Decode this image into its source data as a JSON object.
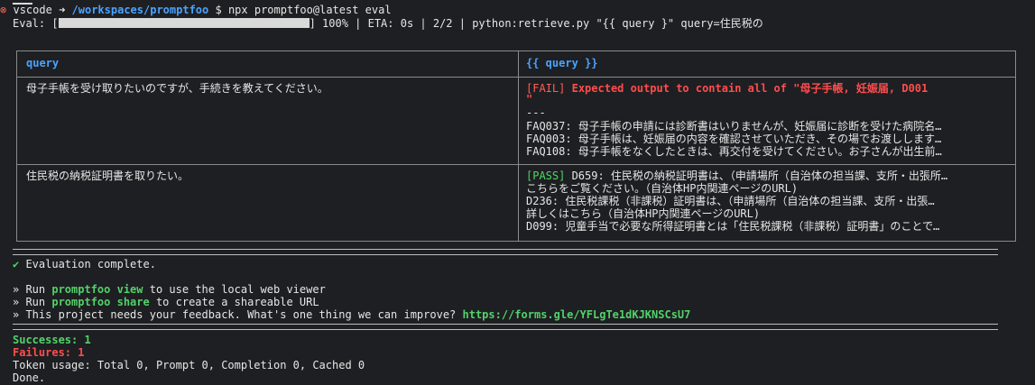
{
  "prompt": {
    "x_icon": "⊗",
    "user": "vscode",
    "arrow": "➜",
    "path": "/workspaces/promptfoo",
    "symbol": "$",
    "command": "npx promptfoo@latest eval"
  },
  "progress": {
    "label": "Eval: [",
    "fill_fraction": 1.0,
    "suffix": "] 100% | ETA: 0s | 2/2 | python:retrieve.py \"{{ query }\" query=住民税の"
  },
  "table": {
    "headers": [
      "query",
      "{{ query }}"
    ],
    "rows": [
      {
        "query": "母子手帳を受け取りたいのですが、手続きを教えてください。",
        "status": "[FAIL]",
        "message": "Expected output to contain all of \"母子手帳, 妊娠届, D001",
        "quote": "\"",
        "divider": "---",
        "lines": [
          "FAQ037: 母子手帳の申請には診断書はいりませんが、妊娠届に診断を受けた病院名…",
          "FAQ003: 母子手帳は、妊娠届の内容を確認させていただき、その場でお渡しします…",
          "FAQ108: 母子手帳をなくしたときは、再交付を受けてください。お子さんが出生前…"
        ]
      },
      {
        "query": "住民税の納税証明書を取りたい。",
        "status": "[PASS]",
        "message": " D659: 住民税の納税証明書は、（申請場所（自治体の担当課、支所・出張所…",
        "lines": [
          "こちらをご覧ください。（自治体HP内関連ページのURL)",
          "D236: 住民税課税（非課税）証明書は、（申請場所（自治体の担当課、支所・出張…",
          "詳しくはこちら（自治体HP内関連ページのURL)",
          "D099: 児童手当で必要な所得証明書とは「住民税課税（非課税）証明書」のことで…"
        ]
      }
    ]
  },
  "complete": {
    "check": "✔",
    "text": " Evaluation complete."
  },
  "tips": {
    "l1_pre": "» Run ",
    "l1_cmd": "promptfoo view",
    "l1_post": " to use the local web viewer",
    "l2_pre": "» Run ",
    "l2_cmd": "promptfoo share",
    "l2_post": " to create a shareable URL",
    "l3_pre": "» This project needs your feedback. What's one thing we can improve? ",
    "l3_link": "https://forms.gle/YFLgTe1dKJKNSCsU7"
  },
  "summary": {
    "successes": "Successes: 1",
    "failures": "Failures: 1",
    "tokens": "Token usage: Total 0, Prompt 0, Completion 0, Cached 0",
    "done": "Done."
  }
}
